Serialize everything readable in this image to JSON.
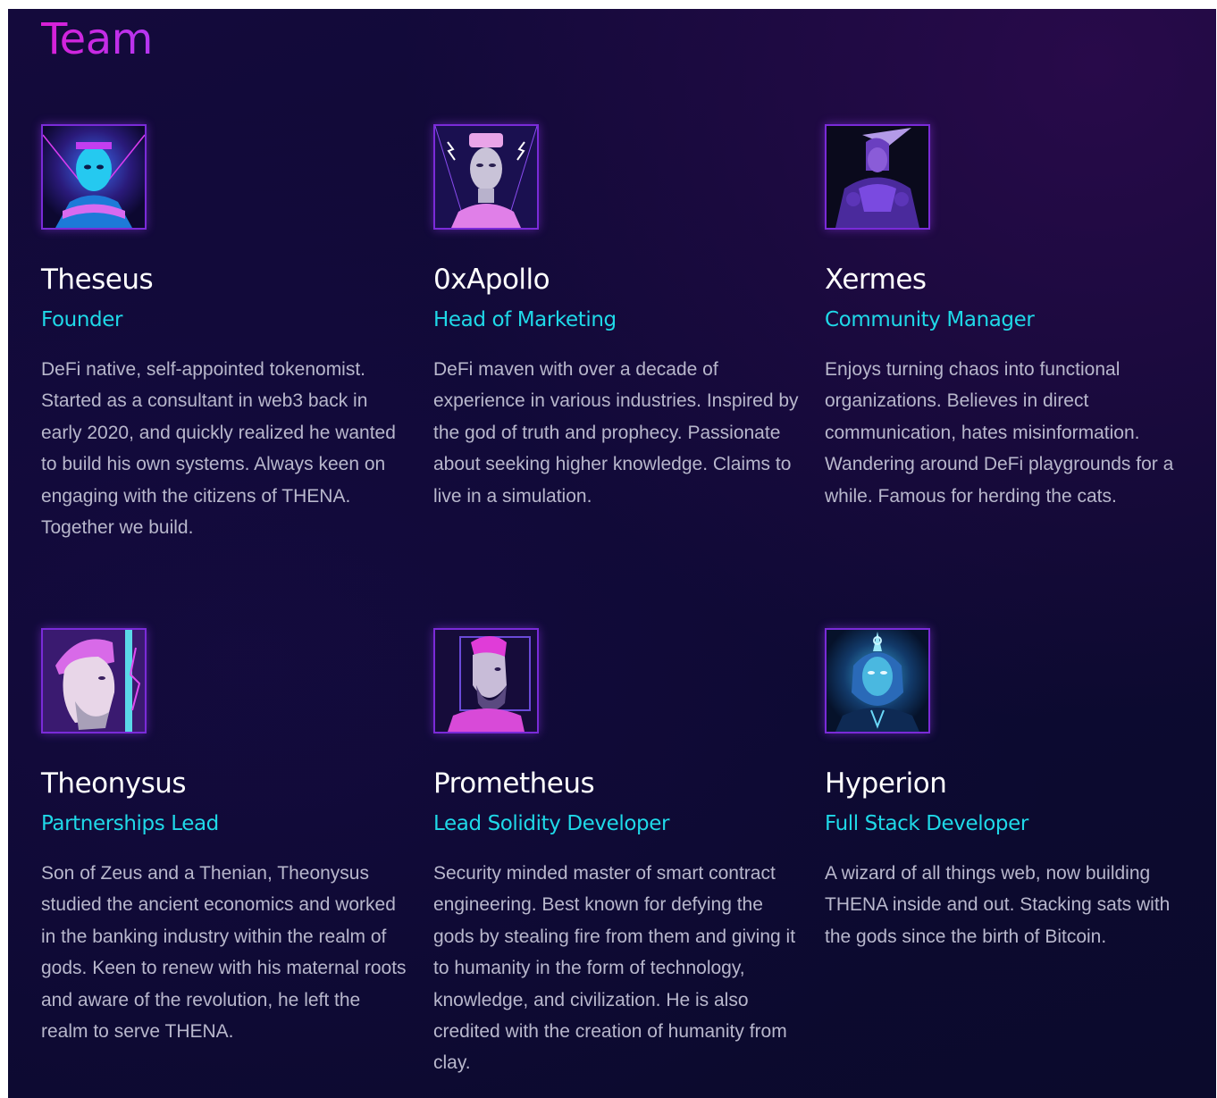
{
  "section": {
    "title": "Team"
  },
  "members": [
    {
      "name": "Theseus",
      "role": "Founder",
      "bio": "DeFi native, self-appointed tokenomist. Started as a consultant in web3 back in early 2020, and quickly realized he wanted to build his own systems. Always keen on engaging with the citizens of THENA. Together we build.",
      "avatar_icon": "portrait-theseus-icon"
    },
    {
      "name": "0xApollo",
      "role": "Head of Marketing",
      "bio": "DeFi maven with over a decade of experience in various industries. Inspired by the god of truth and prophecy. Passionate about seeking higher knowledge. Claims to live in a simulation.",
      "avatar_icon": "portrait-apollo-icon"
    },
    {
      "name": "Xermes",
      "role": "Community Manager",
      "bio": "Enjoys turning chaos into functional organizations. Believes in direct communication, hates misinformation. Wandering around DeFi playgrounds for a while. Famous for herding the cats.",
      "avatar_icon": "portrait-xermes-icon"
    },
    {
      "name": "Theonysus",
      "role": "Partnerships Lead",
      "bio": "Son of Zeus and a Thenian, Theonysus studied the ancient economics and worked in the banking industry within the realm of gods. Keen to renew with his maternal roots and aware of the revolution, he left the realm to serve THENA.",
      "avatar_icon": "portrait-theonysus-icon"
    },
    {
      "name": "Prometheus",
      "role": "Lead Solidity Developer",
      "bio": "Security minded master of smart contract engineering. Best known for defying the gods by stealing fire from them and giving it to humanity in the form of technology, knowledge, and civilization. He is also credited with the creation of humanity from clay.",
      "avatar_icon": "portrait-prometheus-icon"
    },
    {
      "name": "Hyperion",
      "role": "Full Stack Developer",
      "bio": "A wizard of all things web, now building THENA inside and out. Stacking sats with the gods since the birth of Bitcoin.",
      "avatar_icon": "portrait-hyperion-icon"
    }
  ],
  "colors": {
    "title_gradient_start": "#d91fd6",
    "title_gradient_end": "#b536f2",
    "role_color": "#1fd9e8",
    "bio_color": "#b8b7cc",
    "name_color": "#ffffff",
    "background": "#0f0a35"
  }
}
